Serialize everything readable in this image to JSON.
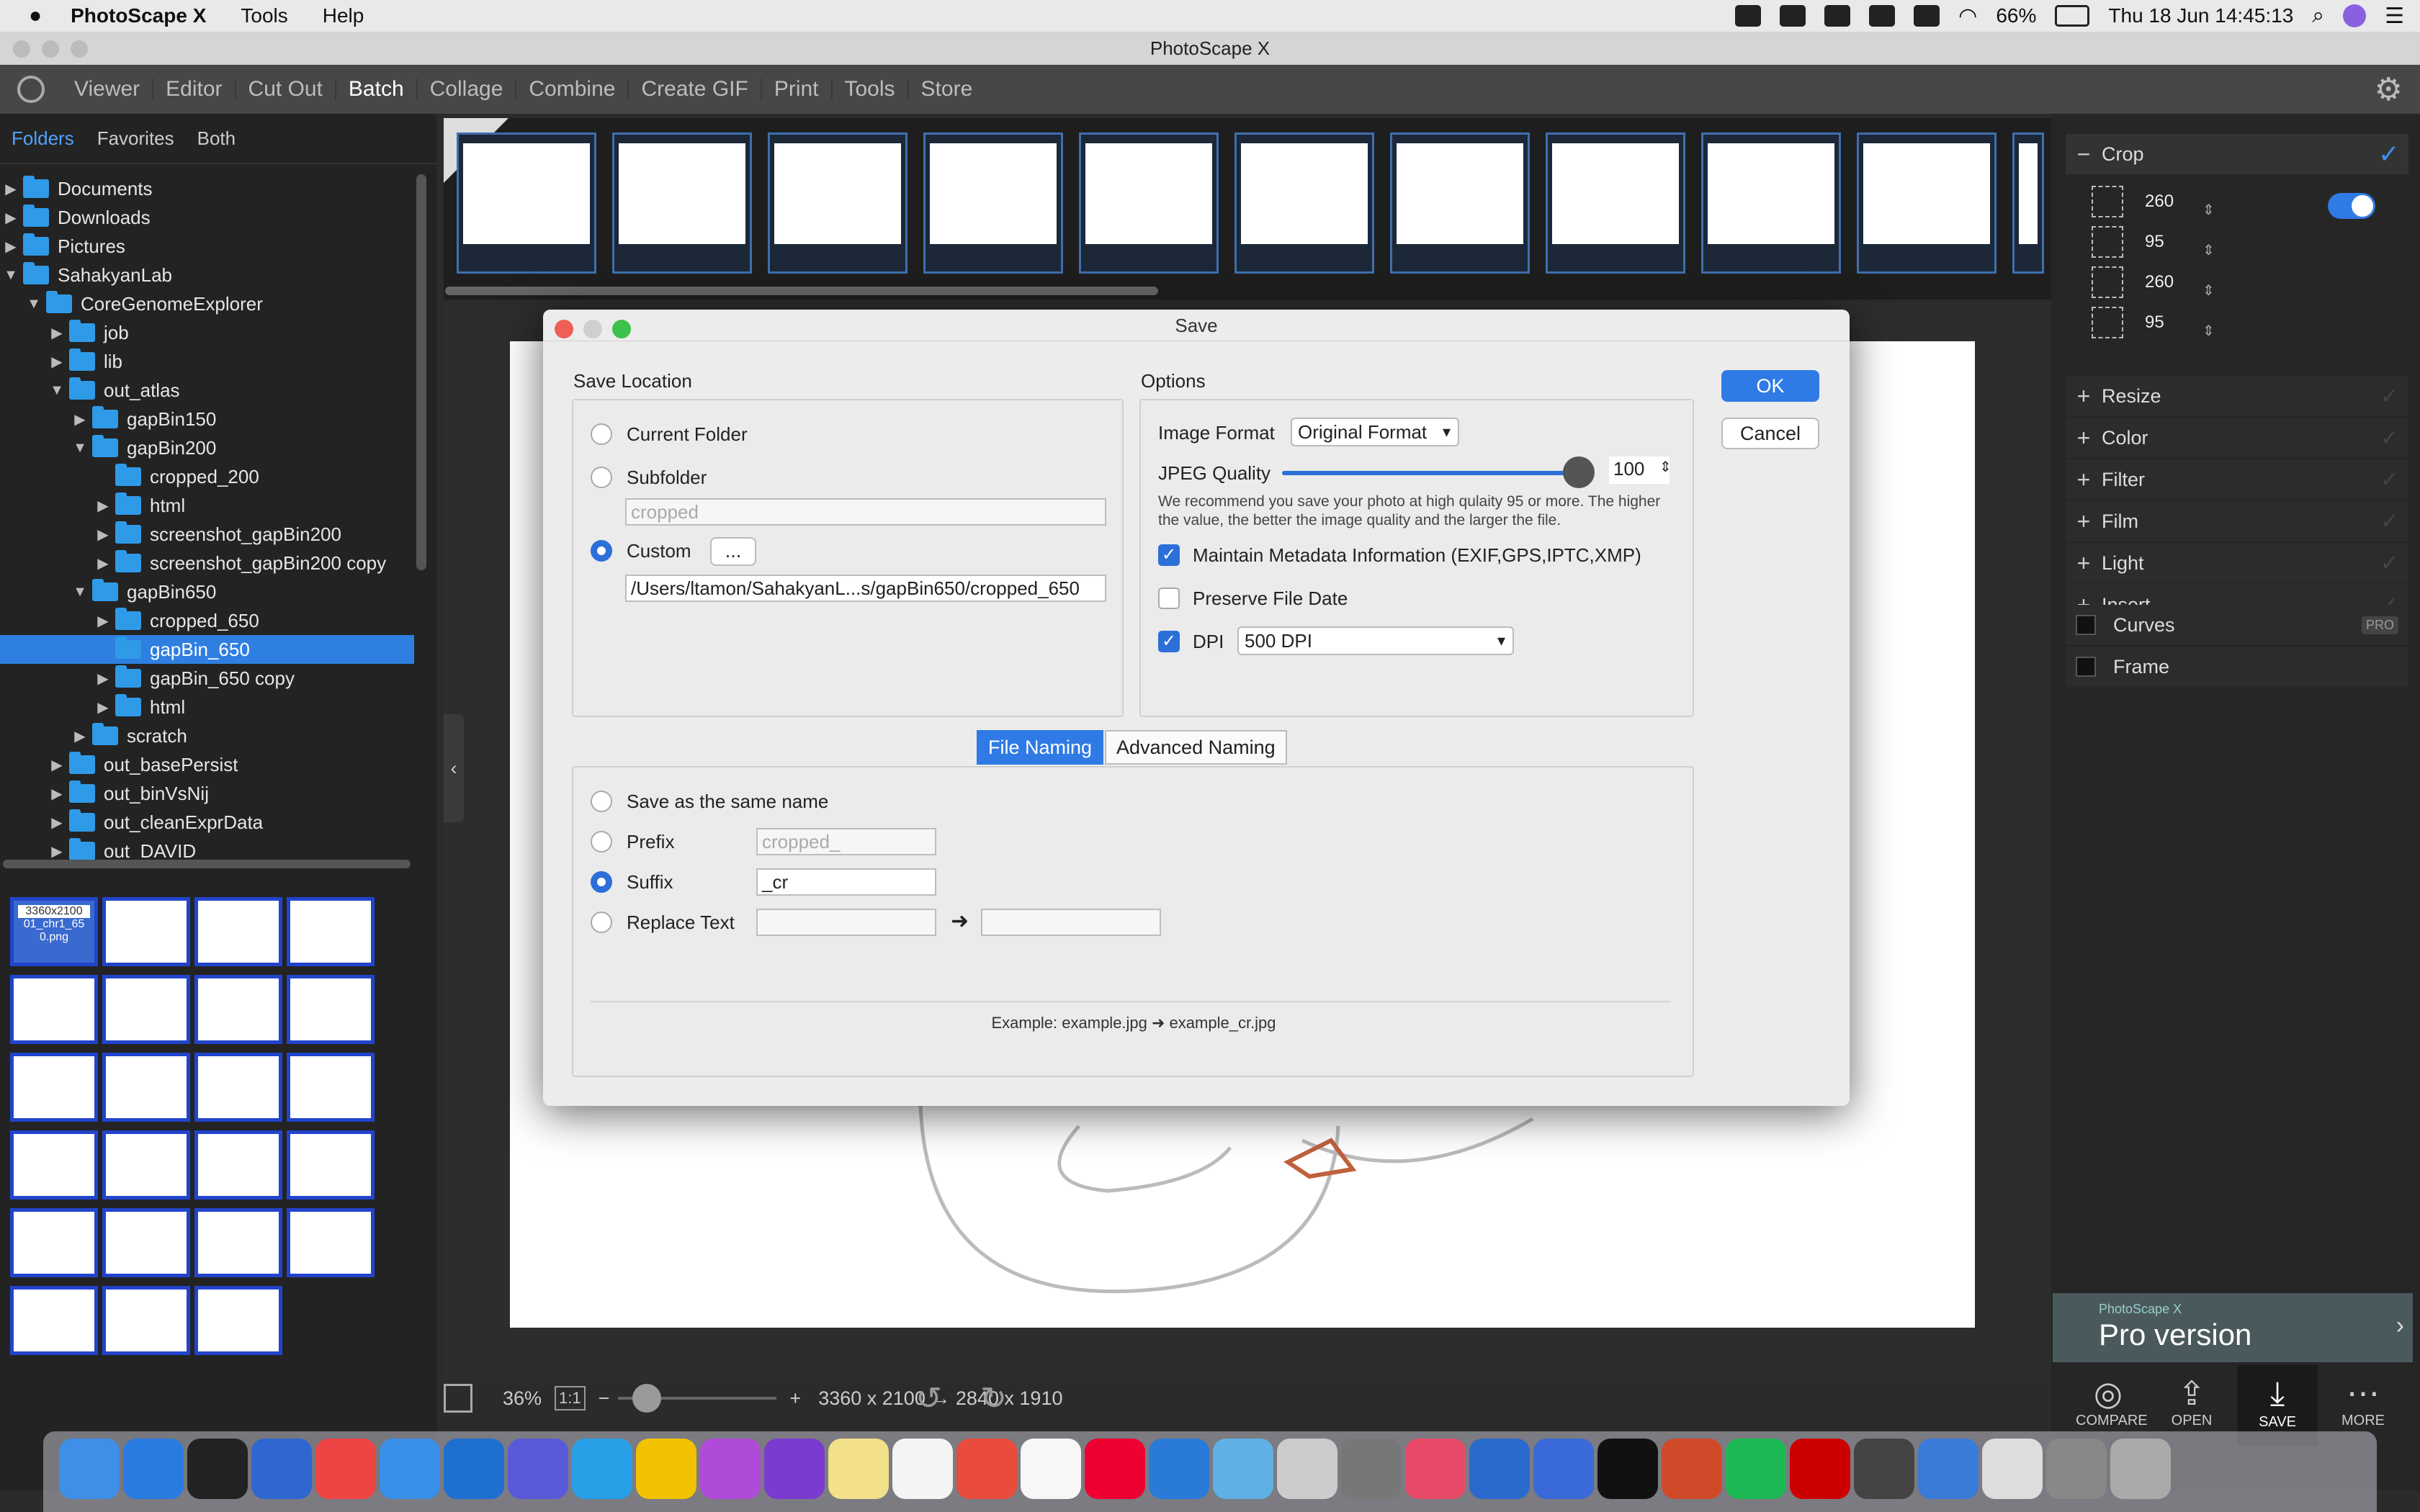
{
  "menubar": {
    "app": "PhotoScape X",
    "items": [
      "Tools",
      "Help"
    ],
    "battery": "66%",
    "datetime": "Thu 18 Jun  14:45:13"
  },
  "window": {
    "title": "PhotoScape X"
  },
  "toolbar": {
    "tabs": [
      "Viewer",
      "Editor",
      "Cut Out",
      "Batch",
      "Collage",
      "Combine",
      "Create GIF",
      "Print",
      "Tools",
      "Store"
    ],
    "active": "Batch"
  },
  "left": {
    "tabs": [
      "Folders",
      "Favorites",
      "Both"
    ],
    "active_tab": "Folders",
    "tree": [
      {
        "label": "Documents",
        "depth": 0,
        "arrow": "▶"
      },
      {
        "label": "Downloads",
        "depth": 0,
        "arrow": "▶"
      },
      {
        "label": "Pictures",
        "depth": 0,
        "arrow": "▶"
      },
      {
        "label": "SahakyanLab",
        "depth": 0,
        "arrow": "▼"
      },
      {
        "label": "CoreGenomeExplorer",
        "depth": 1,
        "arrow": "▼"
      },
      {
        "label": "job",
        "depth": 2,
        "arrow": "▶"
      },
      {
        "label": "lib",
        "depth": 2,
        "arrow": "▶"
      },
      {
        "label": "out_atlas",
        "depth": 2,
        "arrow": "▼"
      },
      {
        "label": "gapBin150",
        "depth": 3,
        "arrow": "▶"
      },
      {
        "label": "gapBin200",
        "depth": 3,
        "arrow": "▼"
      },
      {
        "label": "cropped_200",
        "depth": 4,
        "arrow": ""
      },
      {
        "label": "html",
        "depth": 4,
        "arrow": "▶"
      },
      {
        "label": "screenshot_gapBin200",
        "depth": 4,
        "arrow": "▶"
      },
      {
        "label": "screenshot_gapBin200 copy",
        "depth": 4,
        "arrow": "▶"
      },
      {
        "label": "gapBin650",
        "depth": 3,
        "arrow": "▼"
      },
      {
        "label": "cropped_650",
        "depth": 4,
        "arrow": "▶"
      },
      {
        "label": "gapBin_650",
        "depth": 4,
        "arrow": "",
        "selected": true
      },
      {
        "label": "gapBin_650 copy",
        "depth": 4,
        "arrow": "▶"
      },
      {
        "label": "html",
        "depth": 4,
        "arrow": "▶"
      },
      {
        "label": "scratch",
        "depth": 3,
        "arrow": "▶"
      },
      {
        "label": "out_basePersist",
        "depth": 2,
        "arrow": "▶"
      },
      {
        "label": "out_binVsNij",
        "depth": 2,
        "arrow": "▶"
      },
      {
        "label": "out_cleanExprData",
        "depth": 2,
        "arrow": "▶"
      },
      {
        "label": "out_DAVID",
        "depth": 2,
        "arrow": "▶"
      }
    ],
    "first_thumb": {
      "size": "3360x2100",
      "name": "01_chr1_65\n0.png"
    }
  },
  "right": {
    "crop": {
      "label": "Crop",
      "values": [
        "260",
        "95",
        "260",
        "95"
      ]
    },
    "sections": [
      "Resize",
      "Color",
      "Filter",
      "Film",
      "Light",
      "Insert"
    ],
    "extras": [
      "Curves",
      "Frame"
    ],
    "pro_badge": "PRO",
    "promo_small": "PhotoScape X",
    "promo": "Pro version",
    "actions": [
      "COMPARE",
      "OPEN",
      "SAVE",
      "MORE"
    ]
  },
  "bottom": {
    "zoom": "36%",
    "ratio": "1:1",
    "dims": "3360 x 2100 → 2840 x 1910"
  },
  "dialog": {
    "title": "Save",
    "save_location": {
      "label": "Save Location",
      "current": "Current Folder",
      "subfolder": "Subfolder",
      "subfolder_value": "cropped",
      "custom": "Custom",
      "browse": "...",
      "path": "/Users/ltamon/SahakyanL...s/gapBin650/cropped_650",
      "selected": "Custom"
    },
    "options": {
      "label": "Options",
      "image_format_label": "Image Format",
      "image_format": "Original Format",
      "jpeg_label": "JPEG Quality",
      "jpeg_value": "100",
      "jpeg_level": 1.0,
      "note": "We recommend you save your photo at high qulaity 95 or more. The higher the value, the better the image quality and the larger the file.",
      "metadata": "Maintain Metadata Information (EXIF,GPS,IPTC,XMP)",
      "metadata_checked": true,
      "preserve": "Preserve File Date",
      "preserve_checked": false,
      "dpi": "DPI",
      "dpi_checked": true,
      "dpi_value": "500 DPI"
    },
    "buttons": {
      "ok": "OK",
      "cancel": "Cancel"
    },
    "naming": {
      "tabs": [
        "File Naming",
        "Advanced Naming"
      ],
      "active": "File Naming",
      "same": "Save as the same name",
      "prefix": "Prefix",
      "prefix_value": "cropped_",
      "suffix": "Suffix",
      "suffix_value": "_cr",
      "replace": "Replace Text",
      "selected": "Suffix",
      "example": "Example: example.jpg ➜ example_cr.jpg"
    }
  },
  "colors": {
    "accent": "#2f7ae5",
    "selection": "#2f7fe0",
    "folder": "#2f9ae8"
  }
}
